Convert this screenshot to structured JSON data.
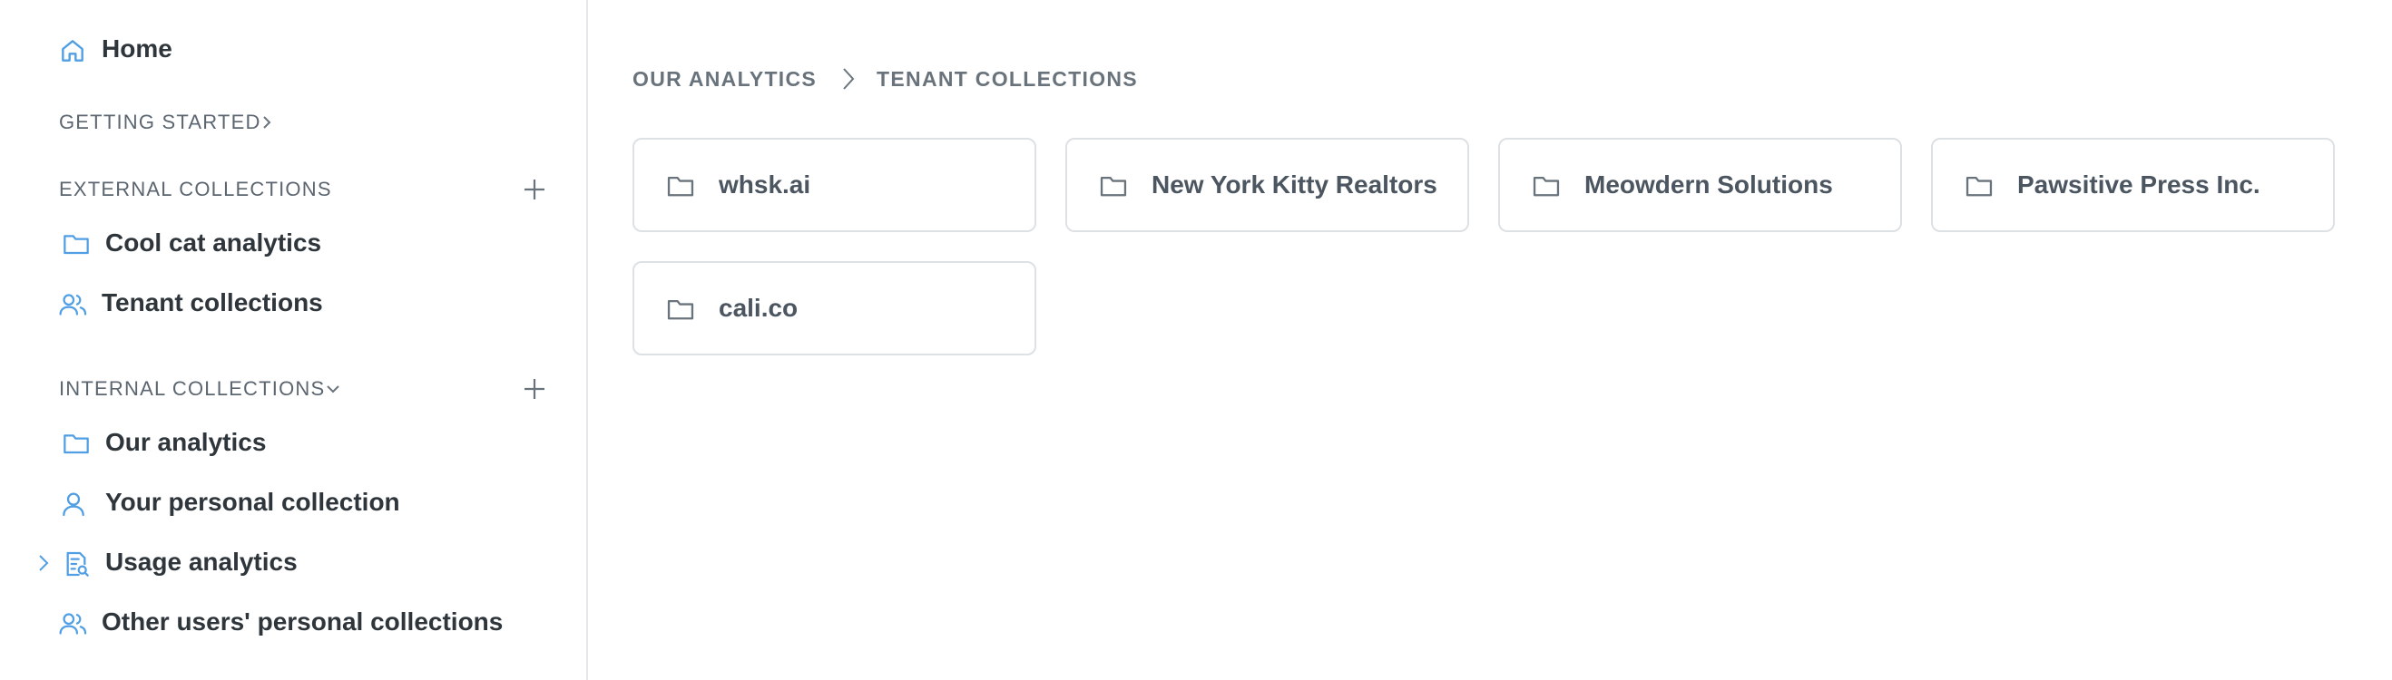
{
  "sidebar": {
    "home_label": "Home",
    "getting_started_label": "GETTING STARTED",
    "external_collections_label": "EXTERNAL COLLECTIONS",
    "external_items": [
      {
        "label": "Cool cat analytics",
        "icon": "folder-icon"
      },
      {
        "label": "Tenant collections",
        "icon": "users-icon"
      }
    ],
    "internal_collections_label": "INTERNAL COLLECTIONS",
    "internal_items": [
      {
        "label": "Our analytics",
        "icon": "folder-icon"
      },
      {
        "label": "Your personal collection",
        "icon": "user-icon"
      },
      {
        "label": "Usage analytics",
        "icon": "report-search-icon"
      },
      {
        "label": "Other users' personal collections",
        "icon": "users-icon"
      }
    ]
  },
  "breadcrumb": {
    "items": [
      "OUR ANALYTICS",
      "TENANT COLLECTIONS"
    ]
  },
  "collections": [
    {
      "label": "whsk.ai"
    },
    {
      "label": "New York Kitty Realtors"
    },
    {
      "label": "Meowdern Solutions"
    },
    {
      "label": "Pawsitive Press Inc."
    },
    {
      "label": "cali.co"
    }
  ],
  "colors": {
    "accent": "#509ee3",
    "text": "#2e353b",
    "muted": "#5c6670",
    "border": "#dde1e4"
  }
}
